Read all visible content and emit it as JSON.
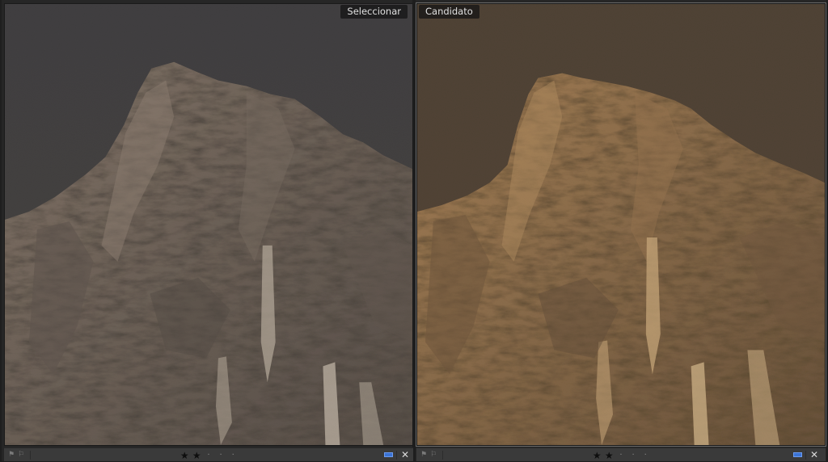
{
  "panes": {
    "select": {
      "label": "Seleccionar",
      "rating": 2,
      "rating_max": 5,
      "color_label": "blue",
      "tint": "#8a7a6a"
    },
    "candidate": {
      "label": "Candidato",
      "rating": 2,
      "rating_max": 5,
      "color_label": "blue",
      "tint": "#b58a55"
    }
  },
  "glyphs": {
    "star": "★",
    "dot": "·",
    "close": "✕",
    "flag_pick": "⚑",
    "flag_reject": "⚐"
  },
  "colors": {
    "sky_select": "#2c2e33",
    "sky_candidate": "#3a3028",
    "rock_select": "#6b5e52",
    "rock_candidate": "#8c6a45",
    "label_blue": "#3b73d4"
  }
}
